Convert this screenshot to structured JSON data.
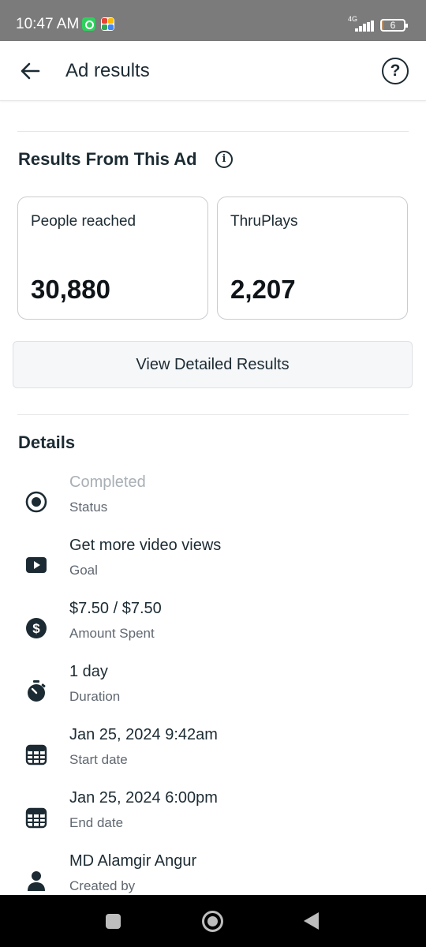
{
  "status_bar": {
    "time": "10:47 AM",
    "network": "4G",
    "battery_level": "6",
    "battery_fraction": 0.06
  },
  "header": {
    "title": "Ad results",
    "back_icon": "arrow-left-icon",
    "help_icon": "question-circle-icon",
    "help_glyph": "?"
  },
  "results": {
    "title": "Results From This Ad",
    "info_glyph": "i",
    "cards": [
      {
        "label": "People reached",
        "value": "30,880"
      },
      {
        "label": "ThruPlays",
        "value": "2,207"
      }
    ],
    "view_button": "View Detailed Results"
  },
  "details": {
    "title": "Details",
    "items": [
      {
        "value": "Completed",
        "label": "Status",
        "icon": "radio-selected-icon"
      },
      {
        "value": "Get more video views",
        "label": "Goal",
        "icon": "video-play-icon"
      },
      {
        "value": "$7.50 / $7.50",
        "label": "Amount Spent",
        "icon": "dollar-circle-icon"
      },
      {
        "value": "1 day",
        "label": "Duration",
        "icon": "stopwatch-icon"
      },
      {
        "value": "Jan 25, 2024 9:42am",
        "label": "Start date",
        "icon": "calendar-icon"
      },
      {
        "value": "Jan 25, 2024 6:00pm",
        "label": "End date",
        "icon": "calendar-icon"
      },
      {
        "value": "MD Alamgir Angur",
        "label": "Created by",
        "icon": "person-icon"
      }
    ]
  },
  "colors": {
    "text": "#1c2b33",
    "muted_status": "#a8afb5",
    "secondary": "#606770",
    "status_bar_bg": "#7b7b7b"
  }
}
